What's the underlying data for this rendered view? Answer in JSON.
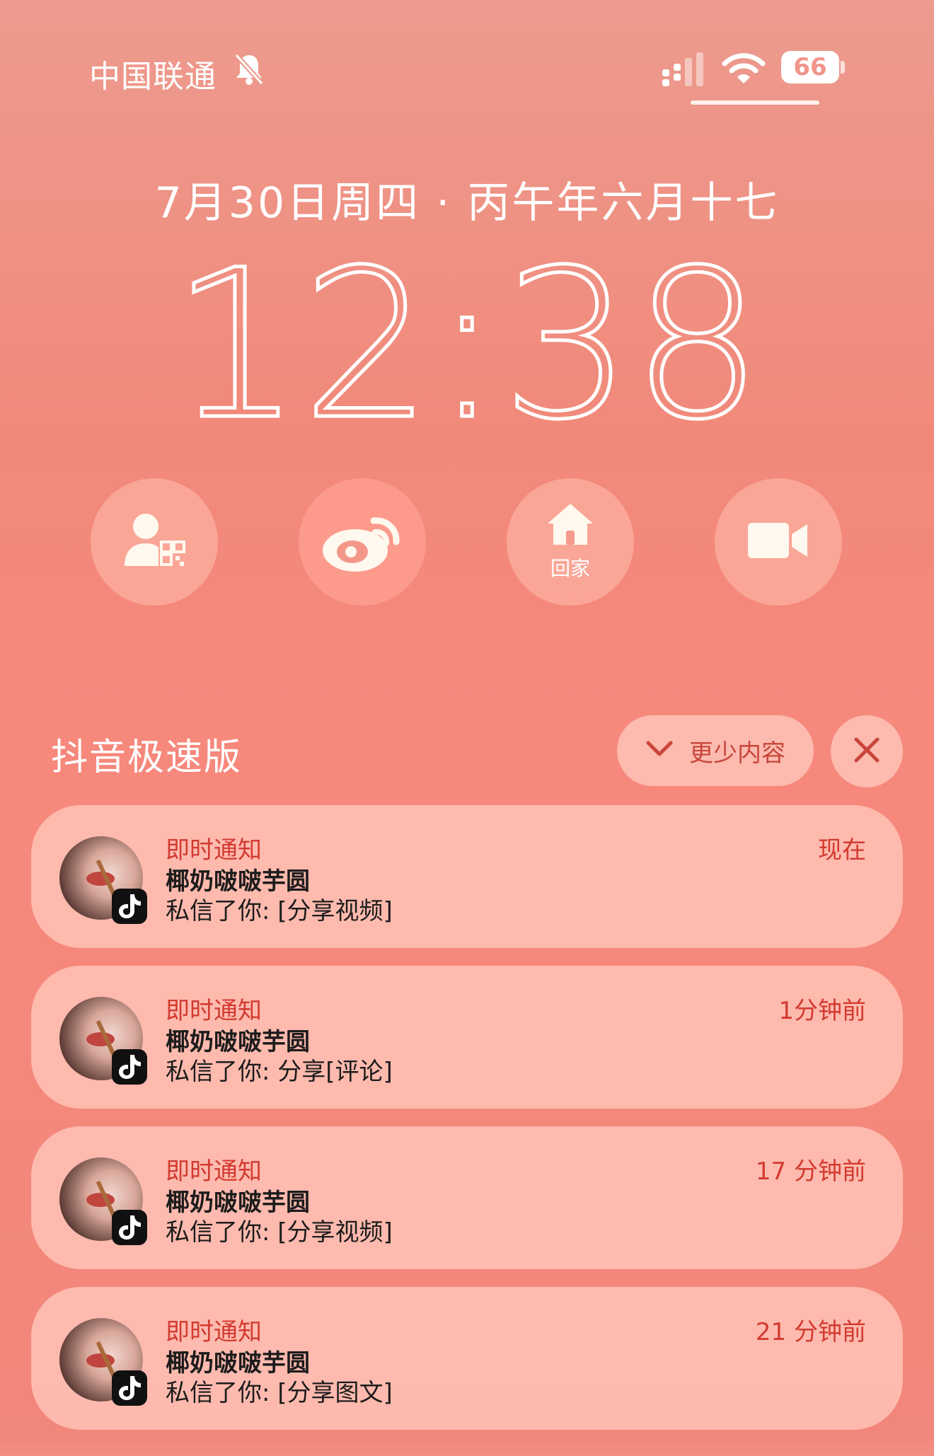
{
  "status_bar": {
    "carrier": "中国联通",
    "battery_percent": "66",
    "icons": [
      "bell-off-icon",
      "signal-icon",
      "wifi-icon",
      "battery-icon"
    ]
  },
  "lockscreen": {
    "date": "7月30日周四 · 丙午年六月十七",
    "time": "12:38"
  },
  "shortcuts": [
    {
      "name": "contact-qr-icon",
      "label": ""
    },
    {
      "name": "weibo-icon",
      "label": ""
    },
    {
      "name": "home-icon",
      "label": "回家"
    },
    {
      "name": "video-camera-icon",
      "label": ""
    }
  ],
  "notification_group": {
    "app_name": "抖音极速版",
    "show_less_label": "更少内容",
    "notifications": [
      {
        "label": "即时通知",
        "time": "现在",
        "sender": "椰奶啵啵芋圆",
        "body": "私信了你: [分享视频]"
      },
      {
        "label": "即时通知",
        "time": "1分钟前",
        "sender": "椰奶啵啵芋圆",
        "body": "私信了你: 分享[评论]"
      },
      {
        "label": "即时通知",
        "time": "17 分钟前",
        "sender": "椰奶啵啵芋圆",
        "body": "私信了你: [分享视频]"
      },
      {
        "label": "即时通知",
        "time": "21 分钟前",
        "sender": "椰奶啵啵芋圆",
        "body": "私信了你: [分享图文]"
      }
    ]
  },
  "colors": {
    "accent_red": "#d23a30",
    "card_bg": "#ffbeb2",
    "background": "#f1897a"
  }
}
